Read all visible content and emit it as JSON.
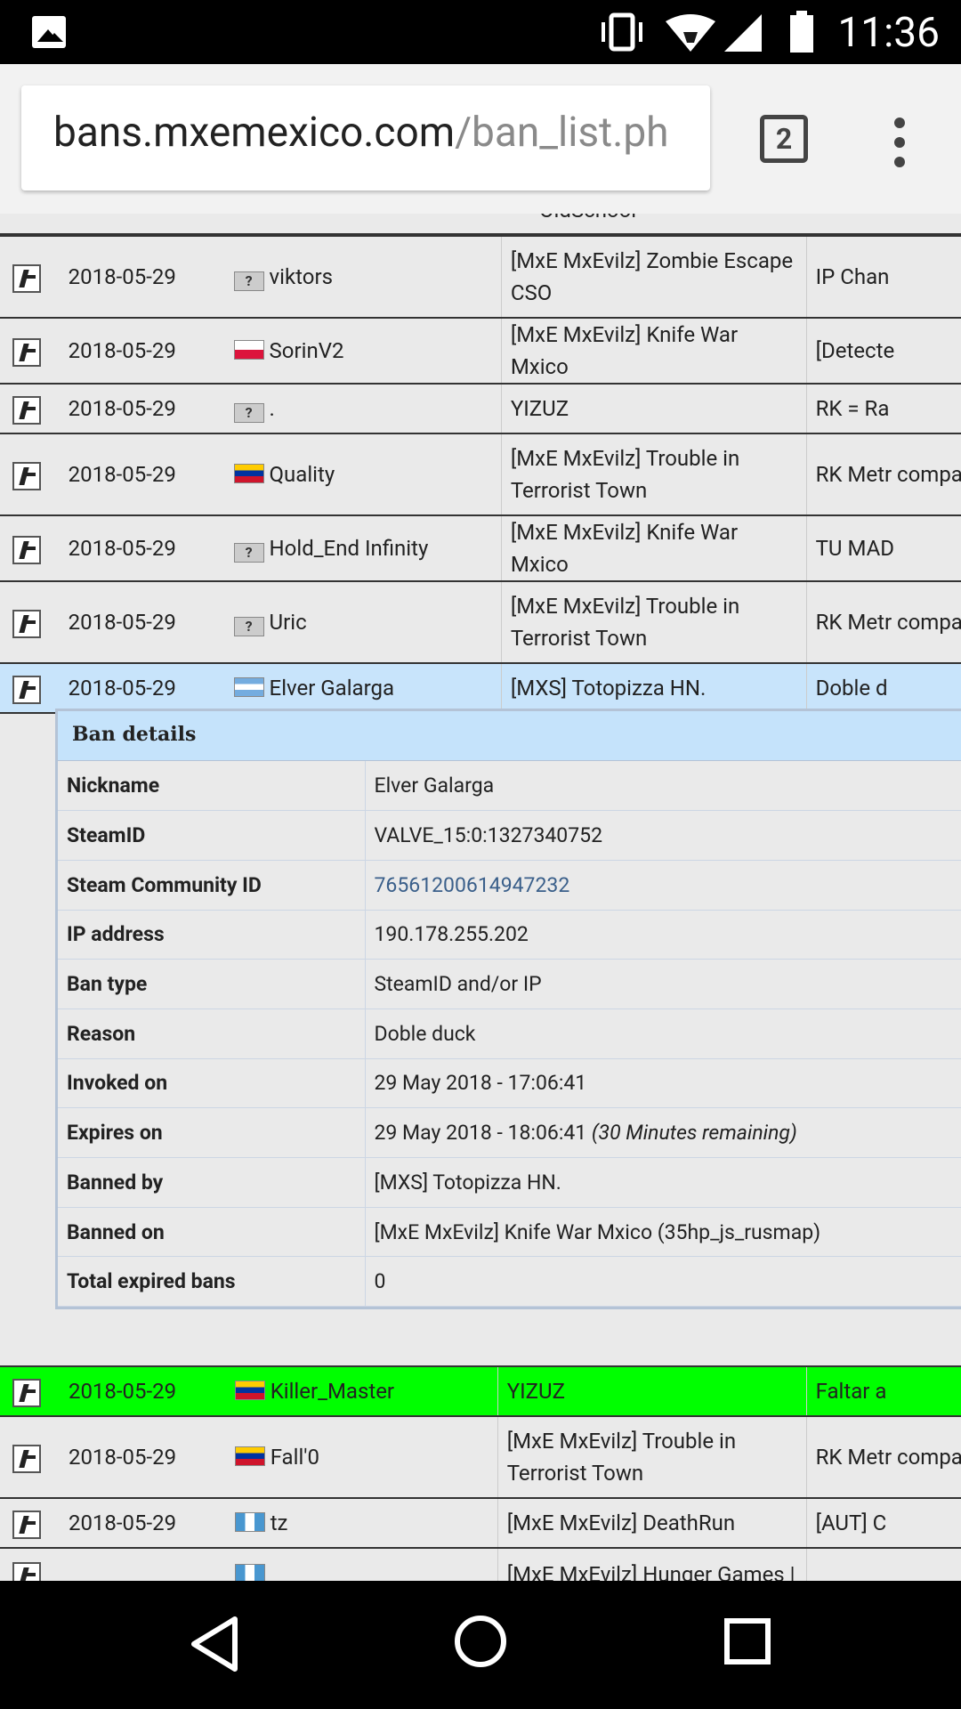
{
  "status_bar": {
    "time": "11:36"
  },
  "browser": {
    "url_host": "bans.mxemexico.com",
    "url_path": "/ban_list.ph",
    "tab_count": "2"
  },
  "top_partial_server": "OldSchool",
  "rows_top": [
    {
      "date": "2018-05-29",
      "flag": "unknown",
      "player": "viktors",
      "server": "[MxE MxEvilz] Zombie Escape CSO",
      "reason": "IP Chan"
    },
    {
      "date": "2018-05-29",
      "flag": "pl",
      "player": "SorinV2",
      "server": "[MxE MxEvilz] Knife War Mxico",
      "reason": "[Detecte"
    },
    {
      "date": "2018-05-29",
      "flag": "unknown",
      "player": ".",
      "server": "YIZUZ",
      "reason": "RK = Ra"
    },
    {
      "date": "2018-05-29",
      "flag": "ve",
      "player": "Quality",
      "server": "[MxE MxEvilz] Trouble in Terrorist Town",
      "reason": "RK Metr compar"
    },
    {
      "date": "2018-05-29",
      "flag": "unknown",
      "player": "Hold_End Infinity",
      "server": "[MxE MxEvilz] Knife War Mxico",
      "reason": "TU MAD"
    },
    {
      "date": "2018-05-29",
      "flag": "unknown",
      "player": "Uric",
      "server": "[MxE MxEvilz] Trouble in Terrorist Town",
      "reason": "RK Metr compar"
    },
    {
      "date": "2018-05-29",
      "flag": "ar",
      "player": "Elver Galarga",
      "server": "[MXS] Totopizza HN.",
      "reason": "Doble d"
    }
  ],
  "details": {
    "title": "Ban details",
    "rows": [
      {
        "label": "Nickname",
        "value": "Elver Galarga"
      },
      {
        "label": "SteamID",
        "value": "VALVE_15:0:1327340752"
      },
      {
        "label": "Steam Community ID",
        "value": "76561200614947232"
      },
      {
        "label": "IP address",
        "value": "190.178.255.202"
      },
      {
        "label": "Ban type",
        "value": "SteamID and/or IP"
      },
      {
        "label": "Reason",
        "value": "Doble duck"
      },
      {
        "label": "Invoked on",
        "value": "29 May 2018 - 17:06:41"
      },
      {
        "label": "Expires on",
        "value": "29 May 2018 - 18:06:41",
        "extra": "(30 Minutes remaining)"
      },
      {
        "label": "Banned by",
        "value": "[MXS] Totopizza HN."
      },
      {
        "label": "Banned on",
        "value": "[MxE MxEvilz] Knife War Mxico (35hp_js_rusmap)"
      },
      {
        "label": "Total expired bans",
        "value": "0"
      }
    ]
  },
  "rows_bottom": [
    {
      "date": "2018-05-29",
      "flag": "ve",
      "player": "Killer_Master",
      "server": "YIZUZ",
      "reason": "Faltar a"
    },
    {
      "date": "2018-05-29",
      "flag": "ve",
      "player": "Fall'0",
      "server": "[MxE MxEvilz] Trouble in Terrorist Town",
      "reason": "RK Metr compar"
    },
    {
      "date": "2018-05-29",
      "flag": "gt",
      "player": "tz",
      "server": "[MxE MxEvilz] DeathRun",
      "reason": "[AUT] C"
    },
    {
      "date": "",
      "flag": "gt",
      "player": "",
      "server": "[MxE MxEvilz] Hunger Games |",
      "reason": ""
    }
  ]
}
